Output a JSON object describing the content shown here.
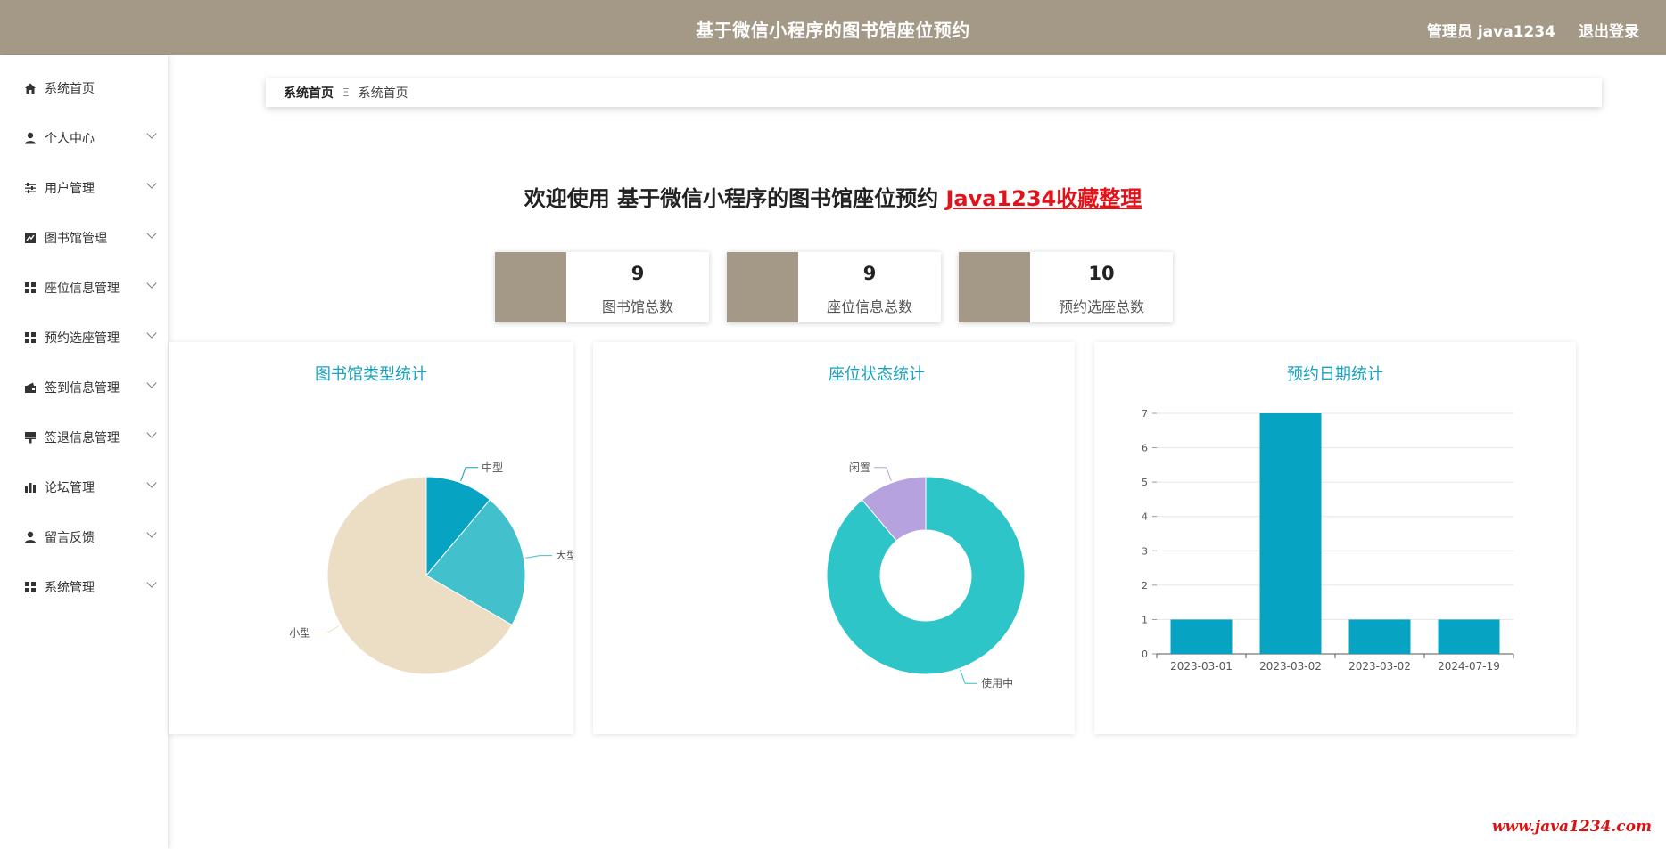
{
  "header": {
    "title": "基于微信小程序的图书馆座位预约",
    "user": "管理员 java1234",
    "logout": "退出登录"
  },
  "sidebar": {
    "items": [
      {
        "label": "系统首页",
        "icon": "home-icon",
        "expandable": false
      },
      {
        "label": "个人中心",
        "icon": "user-icon",
        "expandable": true
      },
      {
        "label": "用户管理",
        "icon": "sliders-icon",
        "expandable": true
      },
      {
        "label": "图书馆管理",
        "icon": "trend-chart-icon",
        "expandable": true
      },
      {
        "label": "座位信息管理",
        "icon": "grid-icon",
        "expandable": true
      },
      {
        "label": "预约选座管理",
        "icon": "grid-icon",
        "expandable": true
      },
      {
        "label": "签到信息管理",
        "icon": "wallet-icon",
        "expandable": true
      },
      {
        "label": "签退信息管理",
        "icon": "stamp-icon",
        "expandable": true
      },
      {
        "label": "论坛管理",
        "icon": "bar-chart-icon",
        "expandable": true
      },
      {
        "label": "留言反馈",
        "icon": "user-icon",
        "expandable": true
      },
      {
        "label": "系统管理",
        "icon": "grid-icon",
        "expandable": true
      }
    ]
  },
  "breadcrumb": {
    "root": "系统首页",
    "separator": "Ξ",
    "current": "系统首页"
  },
  "welcome": {
    "prefix": "欢迎使用 基于微信小程序的图书馆座位预约 ",
    "link": "Java1234收藏整理"
  },
  "stats": [
    {
      "value": "9",
      "label": "图书馆总数"
    },
    {
      "value": "9",
      "label": "座位信息总数"
    },
    {
      "value": "10",
      "label": "预约选座总数"
    }
  ],
  "colors": {
    "brand": "#a39986",
    "chart_title": "#1aa3bf",
    "link": "#e0131b"
  },
  "chart_data": [
    {
      "type": "pie",
      "title": "图书馆类型统计",
      "slices": [
        {
          "label": "中型",
          "value": 1,
          "color": "#07a3c3"
        },
        {
          "label": "大型",
          "value": 2,
          "color": "#42c0cc"
        },
        {
          "label": "小型",
          "value": 6,
          "color": "#ecdec4"
        }
      ]
    },
    {
      "type": "pie",
      "title": "座位状态统计",
      "donut": true,
      "slices": [
        {
          "label": "使用中",
          "value": 8,
          "color": "#2ec5c9"
        },
        {
          "label": "闲置",
          "value": 1,
          "color": "#b6a2de"
        }
      ]
    },
    {
      "type": "bar",
      "title": "预约日期统计",
      "categories": [
        "2023-03-01",
        "2023-03-02",
        "2023-03-02",
        "2024-07-19"
      ],
      "values": [
        1,
        7,
        1,
        1
      ],
      "ylim": [
        0,
        7
      ],
      "yticks": [
        0,
        1,
        2,
        3,
        4,
        5,
        6,
        7
      ],
      "color": "#07a3c3",
      "grid": true
    }
  ],
  "watermark": "www.java1234.com"
}
